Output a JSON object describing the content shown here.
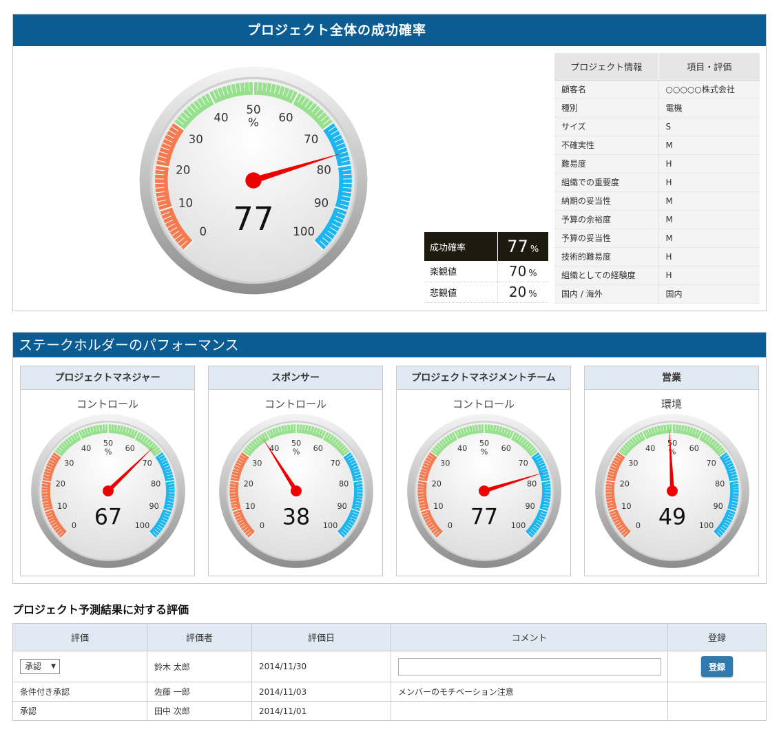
{
  "overall": {
    "title": "プロジェクト全体の成功確率",
    "gauge": {
      "value": 77,
      "unit": "%",
      "ticks": [
        "0",
        "10",
        "20",
        "30",
        "40",
        "50",
        "60",
        "70",
        "80",
        "90",
        "100"
      ]
    },
    "summary": {
      "success_label": "成功確率",
      "success_value": "77",
      "success_unit": "%",
      "optimistic_label": "楽観値",
      "optimistic_value": "70",
      "optimistic_unit": "%",
      "pessimistic_label": "悲観値",
      "pessimistic_value": "20",
      "pessimistic_unit": "%"
    },
    "info": {
      "header_col1": "プロジェクト情報",
      "header_col2": "項目・評価",
      "rows": [
        {
          "label": "顧客名",
          "value": "○○○○○株式会社"
        },
        {
          "label": "種別",
          "value": "電機"
        },
        {
          "label": "サイズ",
          "value": "S"
        },
        {
          "label": "不確実性",
          "value": "M"
        },
        {
          "label": "難易度",
          "value": "H"
        },
        {
          "label": "組織での重要度",
          "value": "H"
        },
        {
          "label": "納期の妥当性",
          "value": "M"
        },
        {
          "label": "予算の余裕度",
          "value": "M"
        },
        {
          "label": "予算の妥当性",
          "value": "M"
        },
        {
          "label": "技術的難易度",
          "value": "H"
        },
        {
          "label": "組織としての経験度",
          "value": "H"
        },
        {
          "label": "国内 / 海外",
          "value": "国内"
        }
      ]
    }
  },
  "stakeholders": {
    "title": "ステークホルダーのパフォーマンス",
    "cards": [
      {
        "title": "プロジェクトマネジャー",
        "subtitle": "コントロール",
        "value": 67
      },
      {
        "title": "スポンサー",
        "subtitle": "コントロール",
        "value": 38
      },
      {
        "title": "プロジェクトマネジメントチーム",
        "subtitle": "コントロール",
        "value": 77
      },
      {
        "title": "営業",
        "subtitle": "環境",
        "value": 49
      }
    ]
  },
  "evaluation": {
    "title": "プロジェクト予測結果に対する評価",
    "headers": [
      "評価",
      "評価者",
      "評価日",
      "コメント",
      "登録"
    ],
    "edit_row": {
      "select_value": "承認",
      "evaluator": "鈴木 太郎",
      "date": "2014/11/30",
      "comment": "",
      "button_label": "登録"
    },
    "rows": [
      {
        "rating": "条件付き承認",
        "evaluator": "佐藤 一郎",
        "date": "2014/11/03",
        "comment": "メンバーのモチベーション注意",
        "register": ""
      },
      {
        "rating": "承認",
        "evaluator": "田中 次郎",
        "date": "2014/11/01",
        "comment": "",
        "register": ""
      }
    ]
  },
  "colors": {
    "header_bg": "#0a5c93",
    "low_band": "#f47a4f",
    "mid_band": "#96e08e",
    "high_band": "#1bb5ef",
    "needle": "#ee0000",
    "button": "#2c7bb2"
  }
}
